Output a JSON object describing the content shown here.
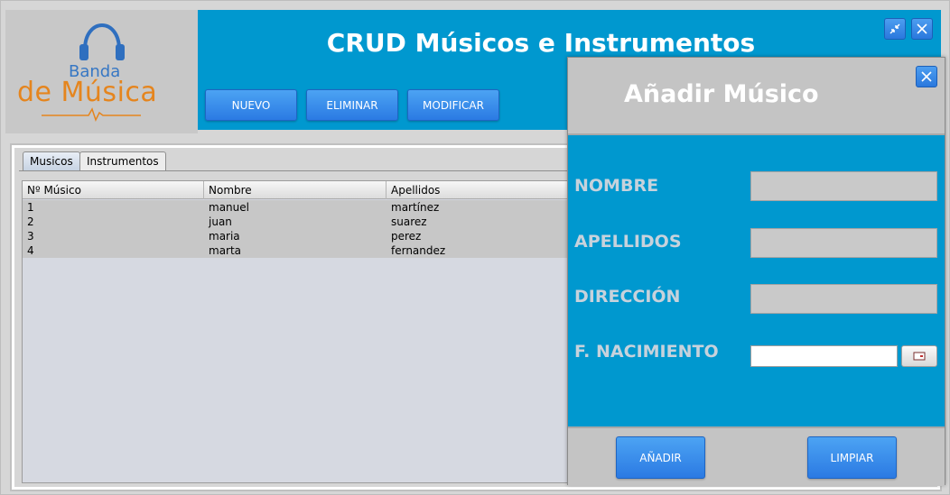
{
  "logo": {
    "line1": "Banda",
    "line2": "de Música",
    "icon": "headphones-icon"
  },
  "header": {
    "title": "CRUD Músicos e Instrumentos",
    "buttons": {
      "nuevo": "NUEVO",
      "eliminar": "ELIMINAR",
      "modificar": "MODIFICAR"
    },
    "window_controls": [
      "minimize-icon",
      "close-icon"
    ],
    "color": "#0098cf"
  },
  "tabs": [
    {
      "label": "Musicos",
      "active": true
    },
    {
      "label": "Instrumentos",
      "active": false
    }
  ],
  "table": {
    "columns": [
      "Nº Músico",
      "Nombre",
      "Apellidos",
      ""
    ],
    "rows": [
      [
        "1",
        "manuel",
        "martínez"
      ],
      [
        "2",
        "juan",
        "suarez"
      ],
      [
        "3",
        "maria",
        "perez"
      ],
      [
        "4",
        "marta",
        "fernandez"
      ]
    ]
  },
  "dialog": {
    "title": "Añadir Músico",
    "fields": {
      "nombre": {
        "label": "NOMBRE",
        "value": ""
      },
      "apellidos": {
        "label": "APELLIDOS",
        "value": ""
      },
      "direccion": {
        "label": "DIRECCIÓN",
        "value": ""
      },
      "nacimiento": {
        "label": "F. NACIMIENTO",
        "value": ""
      }
    },
    "buttons": {
      "anadir": "AÑADIR",
      "limpiar": "LIMPIAR"
    },
    "accent": "#2b7ae3"
  }
}
